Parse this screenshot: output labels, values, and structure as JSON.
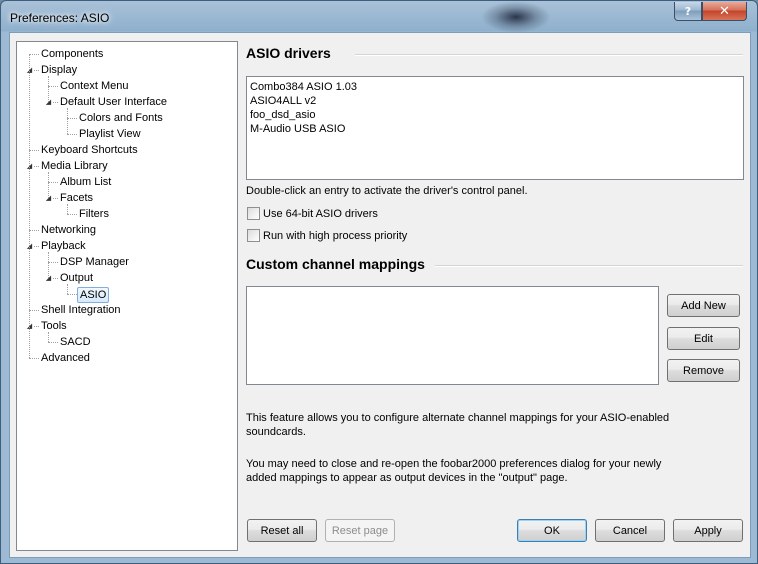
{
  "window": {
    "title": "Preferences: ASIO"
  },
  "caption_buttons": {
    "help": "?",
    "close": "✕"
  },
  "tree": {
    "nodes": [
      {
        "label": "Components",
        "depth": 0,
        "expander": ""
      },
      {
        "label": "Display",
        "depth": 0,
        "expander": "◢"
      },
      {
        "label": "Context Menu",
        "depth": 1,
        "expander": ""
      },
      {
        "label": "Default User Interface",
        "depth": 1,
        "expander": "◢"
      },
      {
        "label": "Colors and Fonts",
        "depth": 2,
        "expander": ""
      },
      {
        "label": "Playlist View",
        "depth": 2,
        "expander": ""
      },
      {
        "label": "Keyboard Shortcuts",
        "depth": 0,
        "expander": ""
      },
      {
        "label": "Media Library",
        "depth": 0,
        "expander": "◢"
      },
      {
        "label": "Album List",
        "depth": 1,
        "expander": ""
      },
      {
        "label": "Facets",
        "depth": 1,
        "expander": "◢"
      },
      {
        "label": "Filters",
        "depth": 2,
        "expander": ""
      },
      {
        "label": "Networking",
        "depth": 0,
        "expander": ""
      },
      {
        "label": "Playback",
        "depth": 0,
        "expander": "◢"
      },
      {
        "label": "DSP Manager",
        "depth": 1,
        "expander": ""
      },
      {
        "label": "Output",
        "depth": 1,
        "expander": "◢"
      },
      {
        "label": "ASIO",
        "depth": 2,
        "expander": "",
        "selected": true
      },
      {
        "label": "Shell Integration",
        "depth": 0,
        "expander": ""
      },
      {
        "label": "Tools",
        "depth": 0,
        "expander": "◢"
      },
      {
        "label": "SACD",
        "depth": 1,
        "expander": ""
      },
      {
        "label": "Advanced",
        "depth": 0,
        "expander": ""
      }
    ]
  },
  "asio_drivers": {
    "header": "ASIO drivers",
    "drivers": [
      "Combo384 ASIO 1.03",
      "ASIO4ALL v2",
      "foo_dsd_asio",
      "M-Audio USB ASIO"
    ],
    "hint": "Double-click an entry to activate the driver's control panel.",
    "use_64bit_label": "Use 64-bit ASIO drivers",
    "use_64bit_checked": false,
    "high_priority_label": "Run with high process priority",
    "high_priority_checked": false
  },
  "channel_mappings": {
    "header": "Custom channel mappings",
    "add_new": "Add New",
    "edit": "Edit",
    "remove": "Remove",
    "info1": "This feature allows you to configure alternate channel mappings for your ASIO-enabled soundcards.",
    "info2": "You may need to close and re-open the foobar2000 preferences dialog for your newly added mappings to appear as output devices in the \"output\" page."
  },
  "footer": {
    "reset_all": "Reset all",
    "reset_page": "Reset page",
    "ok": "OK",
    "cancel": "Cancel",
    "apply": "Apply"
  }
}
